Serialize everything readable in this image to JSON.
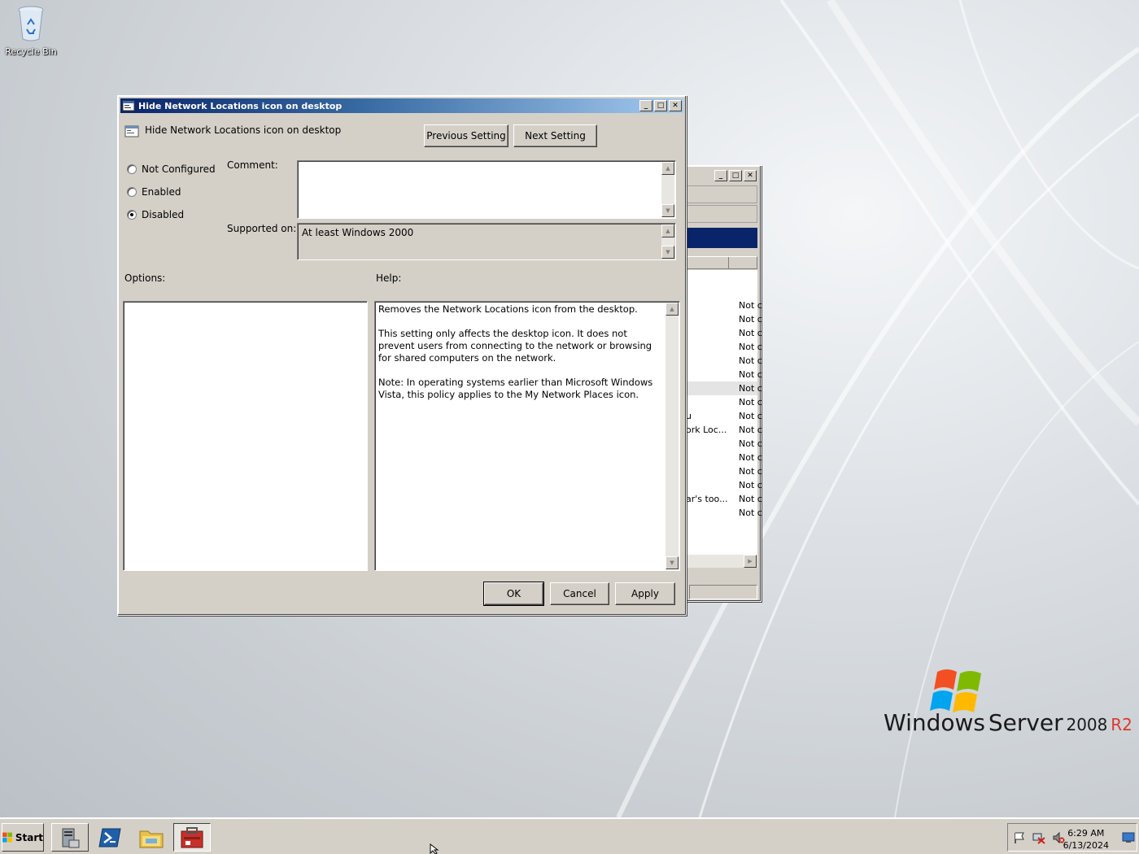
{
  "desktop": {
    "recycle_bin_label": "Recycle Bin",
    "brand": {
      "windows": "Windows",
      "server": "Server",
      "version": "2008",
      "release": "R2"
    }
  },
  "dialog": {
    "title": "Hide Network Locations icon on desktop",
    "setting_name": "Hide Network Locations icon on desktop",
    "previous_setting": "Previous Setting",
    "next_setting": "Next Setting",
    "radio_options": [
      {
        "label": "Not Configured",
        "selected": false
      },
      {
        "label": "Enabled",
        "selected": false
      },
      {
        "label": "Disabled",
        "selected": true
      }
    ],
    "comment_label": "Comment:",
    "comment_value": "",
    "supported_on_label": "Supported on:",
    "supported_on_value": "At least Windows 2000",
    "options_label": "Options:",
    "help_label": "Help:",
    "help_paragraphs": [
      "Removes the Network Locations icon from the desktop.",
      "This setting only affects the desktop icon. It does not prevent users from connecting to the network or browsing for shared computers on the network.",
      "Note: In operating systems earlier than Microsoft Windows Vista, this policy applies to the My Network Places icon."
    ],
    "ok": "OK",
    "cancel": "Cancel",
    "apply": "Apply"
  },
  "background_window": {
    "state_values": [
      "Not c",
      "Not c",
      "Not c",
      "Not c",
      "Not c",
      "Not c",
      "Not c",
      "Not c",
      "Not c",
      "Not c",
      "Not c",
      "Not c",
      "Not c",
      "Not c",
      "Not c",
      "Not c"
    ],
    "fragments": [
      "u",
      "ork Loc...",
      "ar's too..."
    ]
  },
  "taskbar": {
    "start_label": "Start",
    "time": "6:29 AM",
    "date": "6/13/2024"
  },
  "colors": {
    "title_active_start": "#0a246a",
    "title_active_end": "#a6caf0",
    "selection": "#0a246a",
    "face": "#d4d0c8"
  }
}
